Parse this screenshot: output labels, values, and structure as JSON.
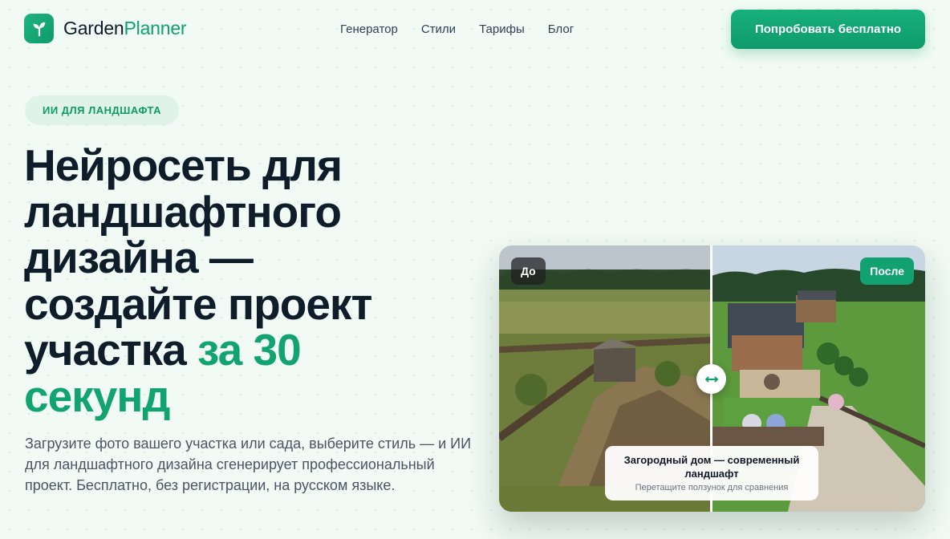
{
  "brand": {
    "name_part1": "Garden",
    "name_part2": "Planner",
    "logo_icon": "sprout-icon"
  },
  "nav": {
    "items": [
      "Генератор",
      "Стили",
      "Тарифы",
      "Блог"
    ]
  },
  "header": {
    "cta_label": "Попробовать бесплатно"
  },
  "hero": {
    "badge": "ИИ ДЛЯ ЛАНДШАФТА",
    "headline_line1": "Нейросеть для",
    "headline_line2": "ландшафтного",
    "headline_line3": "дизайна —",
    "headline_line4": "создайте проект",
    "headline_line5_start": "участка ",
    "headline_line5_accent": "за 30",
    "headline_line6_accent": "секунд",
    "description": "Загрузите фото вашего участка или сада, выберите стиль — и ИИ для ландшафтного дизайна сгенерирует профессиональный проект. Бесплатно, без регистрации, на русском языке."
  },
  "comparison": {
    "before_label": "До",
    "after_label": "После",
    "caption_title": "Загородный дом — современный ландшафт",
    "caption_hint": "Перетащите ползунок для сравнения",
    "handle_icon": "arrows-horizontal-icon",
    "slider_position": 0.5
  },
  "colors": {
    "accent": "#11a371",
    "background": "#f1faf4",
    "text": "#0f1d2a"
  }
}
